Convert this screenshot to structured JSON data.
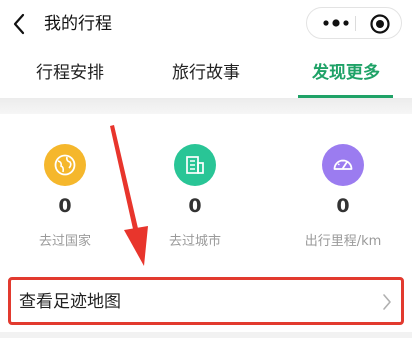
{
  "navbar": {
    "title": "我的行程",
    "back_icon": "chevron-left-icon",
    "more_icon": "more-dots-icon",
    "close_icon": "record-close-icon"
  },
  "tabs": [
    {
      "label": "行程安排",
      "active": false
    },
    {
      "label": "旅行故事",
      "active": false
    },
    {
      "label": "发现更多",
      "active": true
    }
  ],
  "stats": [
    {
      "value": "0",
      "label": "去过国家",
      "icon": "globe-icon",
      "color": "#f5b72c"
    },
    {
      "value": "0",
      "label": "去过城市",
      "icon": "building-icon",
      "color": "#29c596"
    },
    {
      "value": "0",
      "label": "出行里程/km",
      "icon": "speedometer-icon",
      "color": "#9b7cf0"
    }
  ],
  "footprint": {
    "label": "查看足迹地图",
    "icon": "chevron-right-icon"
  },
  "colors": {
    "accent": "#1fa267",
    "highlight_border": "#e23a2f",
    "annotation_arrow": "#e8352c"
  }
}
